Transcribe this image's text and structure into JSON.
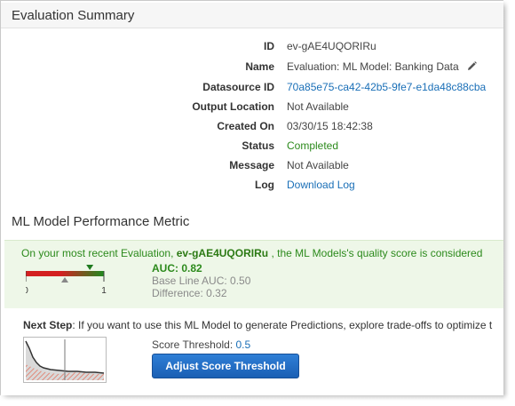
{
  "evaluation_summary": {
    "title": "Evaluation Summary",
    "fields": [
      {
        "key": "ID",
        "value": "ev-gAE4UQORIRu",
        "style": "plain"
      },
      {
        "key": "Name",
        "value": "Evaluation: ML Model: Banking Data",
        "style": "plain",
        "editable": true
      },
      {
        "key": "Datasource ID",
        "value": "70a85e75-ca42-42b5-9fe7-e1da48c88cba",
        "style": "link"
      },
      {
        "key": "Output Location",
        "value": "Not Available",
        "style": "plain"
      },
      {
        "key": "Created On",
        "value": "03/30/15 18:42:38",
        "style": "plain"
      },
      {
        "key": "Status",
        "value": "Completed",
        "style": "green"
      },
      {
        "key": "Message",
        "value": "Not Available",
        "style": "plain"
      },
      {
        "key": "Log",
        "value": "Download Log",
        "style": "link"
      }
    ]
  },
  "performance": {
    "title": "ML Model Performance Metric",
    "message_prefix": "On your most recent Evaluation, ",
    "message_id": "ev-gAE4UQORIRu",
    "message_suffix": " , the ML Models's quality score is considered",
    "gauge": {
      "min_label": "0",
      "max_label": "1",
      "auc_value": 0.82,
      "baseline_value": 0.5,
      "color_bad": "#d32020",
      "color_good": "#1f8a1f",
      "marker_color": "#1f7a1f"
    },
    "auc_text": "AUC: 0.82",
    "baseline_text": "Base Line AUC: 0.50",
    "difference_text": "Difference: 0.32"
  },
  "next_step": {
    "label": "Next Step",
    "text": ": If you want to use this ML Model to generate Predictions, explore trade-offs to optimize t",
    "threshold_label": "Score Threshold: ",
    "threshold_value": "0.5",
    "button_label": "Adjust Score Threshold"
  },
  "colors": {
    "accent": "#1a6fb7",
    "success": "#2c8a1c",
    "button": "#1a5fb4"
  }
}
